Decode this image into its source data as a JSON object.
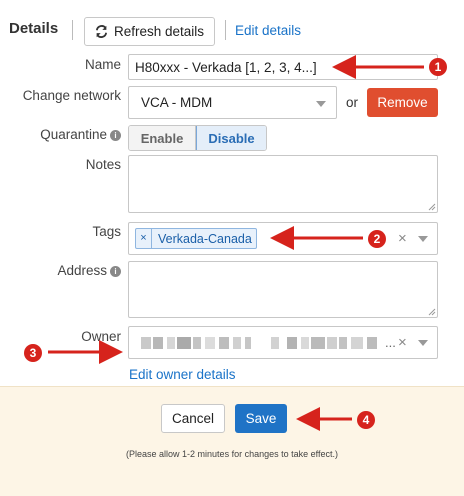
{
  "header": {
    "title": "Details",
    "refresh_label": "Refresh details",
    "edit_label": "Edit details"
  },
  "fields": {
    "name": {
      "label": "Name",
      "value": "H80xxx - Verkada [1, 2, 3, 4...]"
    },
    "network": {
      "label": "Change network",
      "value": "VCA - MDM",
      "or_text": "or",
      "remove_label": "Remove"
    },
    "quarantine": {
      "label": "Quarantine",
      "enable_label": "Enable",
      "disable_label": "Disable",
      "selected": "Disable",
      "info_glyph": "i"
    },
    "notes": {
      "label": "Notes",
      "value": ""
    },
    "tags": {
      "label": "Tags",
      "items": [
        "Verkada-Canada"
      ],
      "remove_glyph": "×"
    },
    "address": {
      "label": "Address",
      "value": "",
      "info_glyph": "i"
    },
    "owner": {
      "label": "Owner",
      "value_suffix": "...",
      "edit_link": "Edit owner details"
    }
  },
  "footer": {
    "cancel_label": "Cancel",
    "save_label": "Save",
    "note": "(Please allow 1-2 minutes for changes to take effect.)"
  },
  "annotations": {
    "markers": [
      "1",
      "2",
      "3",
      "4"
    ],
    "color": "#d6231c"
  },
  "colors": {
    "link": "#1a73c8",
    "remove": "#e04e2f",
    "save": "#1f73c6",
    "footer_bg": "#fdf5e6"
  },
  "icons": {
    "refresh": "refresh-icon",
    "info": "info-icon",
    "dropdown": "chevron-down-icon",
    "clear": "close-icon"
  }
}
